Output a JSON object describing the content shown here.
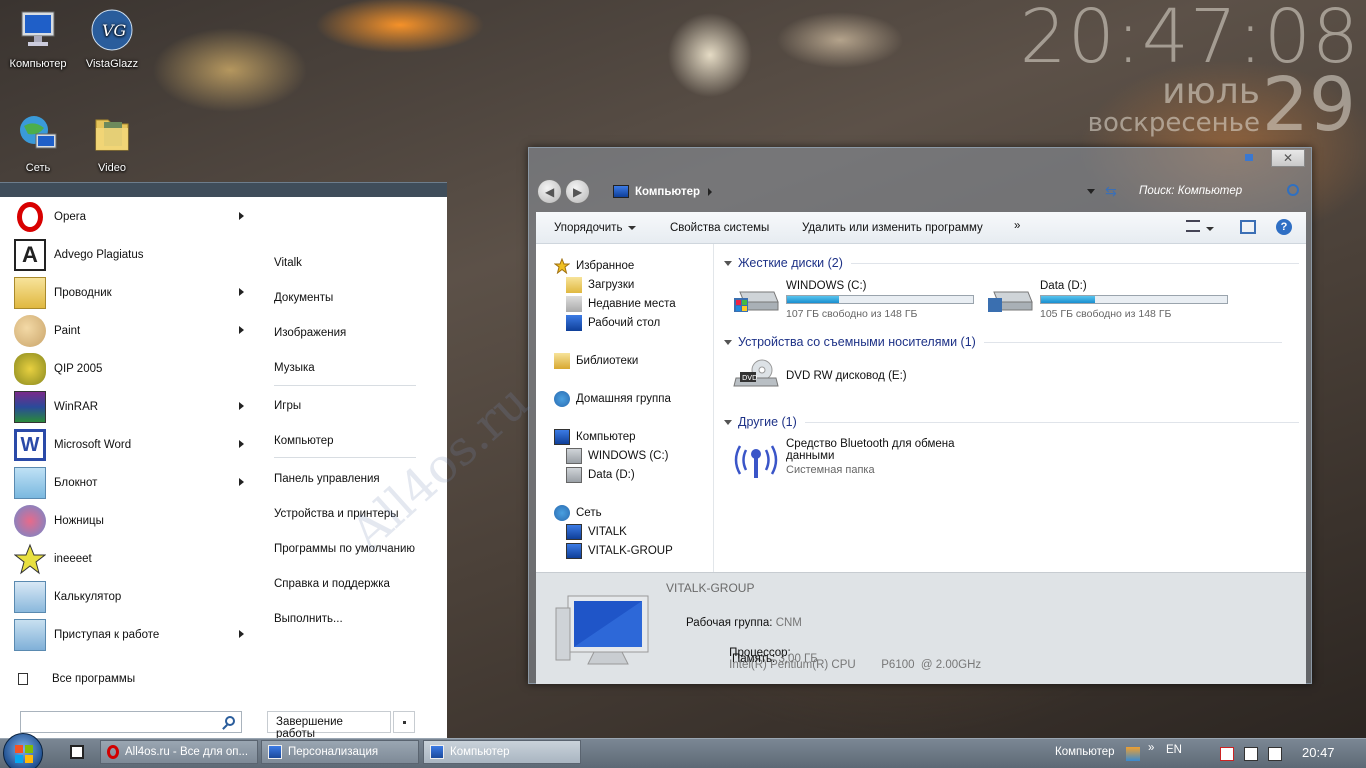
{
  "desktop": {
    "icons": [
      {
        "label": "Компьютер",
        "icon": "computer-icon"
      },
      {
        "label": "VistaGlazz",
        "icon": "vistaglazz-icon"
      },
      {
        "label": "Сеть",
        "icon": "network-icon"
      },
      {
        "label": "Video",
        "icon": "folder-icon"
      }
    ]
  },
  "clock": {
    "time": "20:47:08",
    "month": "июль",
    "weekday": "воскресенье",
    "day": "29"
  },
  "start_menu": {
    "programs": [
      {
        "label": "Opera",
        "icon": "opera-icon",
        "submenu": true
      },
      {
        "label": "Advego Plagiatus",
        "icon": "advego-icon",
        "submenu": false
      },
      {
        "label": "Проводник",
        "icon": "explorer-icon",
        "submenu": true
      },
      {
        "label": "Paint",
        "icon": "paint-icon",
        "submenu": true
      },
      {
        "label": "QIP 2005",
        "icon": "qip-icon",
        "submenu": false
      },
      {
        "label": "WinRAR",
        "icon": "winrar-icon",
        "submenu": true
      },
      {
        "label": "Microsoft Word",
        "icon": "word-icon",
        "submenu": true
      },
      {
        "label": "Блокнот",
        "icon": "notepad-icon",
        "submenu": true
      },
      {
        "label": "Ножницы",
        "icon": "scissors-icon",
        "submenu": false
      },
      {
        "label": "ineeeet",
        "icon": "star-icon",
        "submenu": false
      },
      {
        "label": "Калькулятор",
        "icon": "calculator-icon",
        "submenu": false
      },
      {
        "label": "Приступая к работе",
        "icon": "getting-started-icon",
        "submenu": true
      }
    ],
    "all_programs": "Все программы",
    "search_placeholder": "",
    "places": [
      "Vitalk",
      "Документы",
      "Изображения",
      "Музыка",
      "Игры",
      "Компьютер",
      "Панель управления",
      "Устройства и принтеры",
      "Программы по умолчанию",
      "Справка и поддержка",
      "Выполнить..."
    ],
    "shutdown": "Завершение работы"
  },
  "explorer": {
    "breadcrumb": "Компьютер",
    "search_placeholder": "Поиск: Компьютер",
    "toolbar": {
      "organize": "Упорядочить",
      "system_props": "Свойства системы",
      "uninstall": "Удалить или изменить программу",
      "more": "»"
    },
    "nav": [
      {
        "label": "Избранное",
        "icon": "star-icon",
        "level": 0
      },
      {
        "label": "Загрузки",
        "icon": "downloads-icon",
        "level": 1
      },
      {
        "label": "Недавние места",
        "icon": "recent-icon",
        "level": 1
      },
      {
        "label": "Рабочий стол",
        "icon": "desktop-icon",
        "level": 1
      },
      {
        "label": "Библиотеки",
        "icon": "library-icon",
        "level": 0
      },
      {
        "label": "Домашняя группа",
        "icon": "homegroup-icon",
        "level": 0
      },
      {
        "label": "Компьютер",
        "icon": "computer-icon",
        "level": 0
      },
      {
        "label": "WINDOWS (C:)",
        "icon": "drive-icon",
        "level": 1
      },
      {
        "label": "Data (D:)",
        "icon": "drive-icon",
        "level": 1
      },
      {
        "label": "Сеть",
        "icon": "network-icon",
        "level": 0
      },
      {
        "label": "VITALK",
        "icon": "pc-icon",
        "level": 1
      },
      {
        "label": "VITALK-GROUP",
        "icon": "pc-icon",
        "level": 1
      }
    ],
    "groups": {
      "hdd": "Жесткие диски (2)",
      "removable": "Устройства со съемными носителями (1)",
      "other": "Другие (1)"
    },
    "drives": [
      {
        "name": "WINDOWS (C:)",
        "free": "107 ГБ свободно из 148 ГБ",
        "used_fraction": 0.28
      },
      {
        "name": "Data (D:)",
        "free": "105 ГБ свободно из 148 ГБ",
        "used_fraction": 0.29
      }
    ],
    "dvd": {
      "name": "DVD RW дисковод (E:)"
    },
    "bluetooth": {
      "name_line1": "Средство Bluetooth для обмена",
      "name_line2": "данными",
      "type": "Системная папка"
    },
    "details": {
      "title": "VITALK-GROUP",
      "workgroup_label": "Рабочая группа:",
      "workgroup": "CNM",
      "cpu_label": "Процессор:",
      "cpu": "Intel(R) Pentium(R) CPU        P6100  @ 2.00GHz",
      "ram_label": "Память:",
      "ram": "3,00 ГБ"
    }
  },
  "taskbar": {
    "tasks": [
      {
        "label": "All4os.ru - Все для оп...",
        "icon": "opera-icon"
      },
      {
        "label": "Персонализация",
        "icon": "personalization-icon"
      },
      {
        "label": "Компьютер",
        "icon": "computer-icon"
      }
    ],
    "toolbar_label": "Компьютер",
    "lang": "EN",
    "time": "20:47"
  },
  "watermark": "All4os.ru"
}
